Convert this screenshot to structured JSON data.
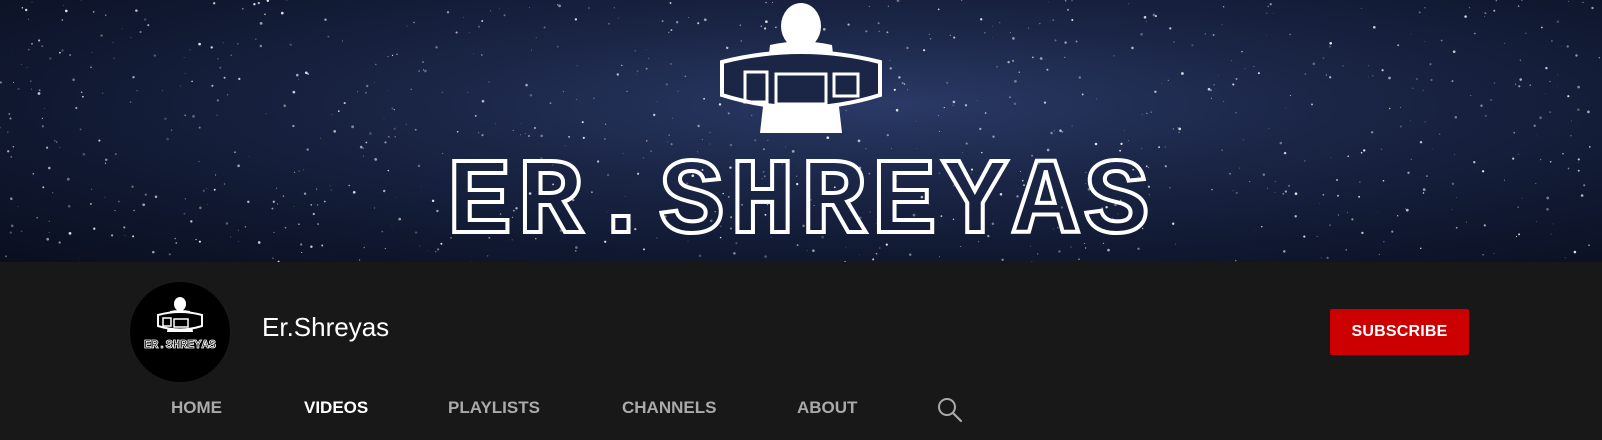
{
  "banner": {
    "title_text": "ER.SHREYAS"
  },
  "channel": {
    "name": "Er.Shreyas",
    "avatar_text": "ER.SHREYAS"
  },
  "subscribe": {
    "label": "SUBSCRIBE",
    "color": "#cc0000"
  },
  "tabs": [
    {
      "label": "HOME",
      "active": false
    },
    {
      "label": "VIDEOS",
      "active": true
    },
    {
      "label": "PLAYLISTS",
      "active": false
    },
    {
      "label": "CHANNELS",
      "active": false
    },
    {
      "label": "ABOUT",
      "active": false
    }
  ],
  "search": {
    "icon": "search-icon"
  }
}
